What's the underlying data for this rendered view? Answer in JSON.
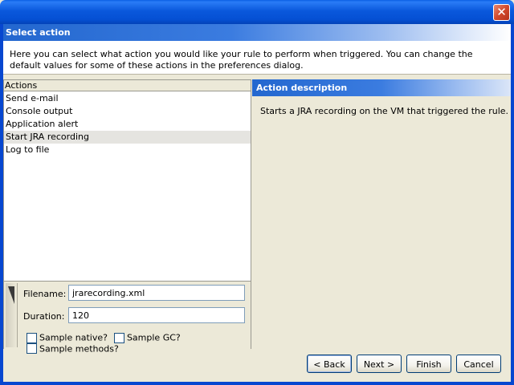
{
  "window": {
    "close_glyph": "✕"
  },
  "header": {
    "title": "Select action"
  },
  "intro": {
    "text": "Here you can select what action you would like your rule to perform when triggered. You can change the default values for some of these actions in the preferences dialog."
  },
  "actions": {
    "header": "Actions",
    "items": [
      {
        "label": "Send e-mail"
      },
      {
        "label": "Console output"
      },
      {
        "label": "Application alert"
      },
      {
        "label": "Start JRA recording",
        "selected": true
      },
      {
        "label": "Log to file"
      }
    ]
  },
  "settings": {
    "filename_label": "Filename:",
    "filename_value": "jrarecording.xml",
    "duration_label": "Duration:",
    "duration_value": "120",
    "checkboxes": [
      {
        "label": "Sample native?",
        "checked": false
      },
      {
        "label": "Sample GC?",
        "checked": false
      },
      {
        "label": "Sample methods?",
        "checked": false
      }
    ]
  },
  "description": {
    "title": "Action description",
    "text": "Starts a JRA recording on the VM that triggered the rule."
  },
  "buttons": {
    "back": "< Back",
    "next": "Next >",
    "finish": "Finish",
    "cancel": "Cancel"
  },
  "colors": {
    "title_bar": "#0a58dc",
    "header_band_start": "#2367cf",
    "selection": "#e5e4e0",
    "window_bg": "#ece9d8"
  }
}
